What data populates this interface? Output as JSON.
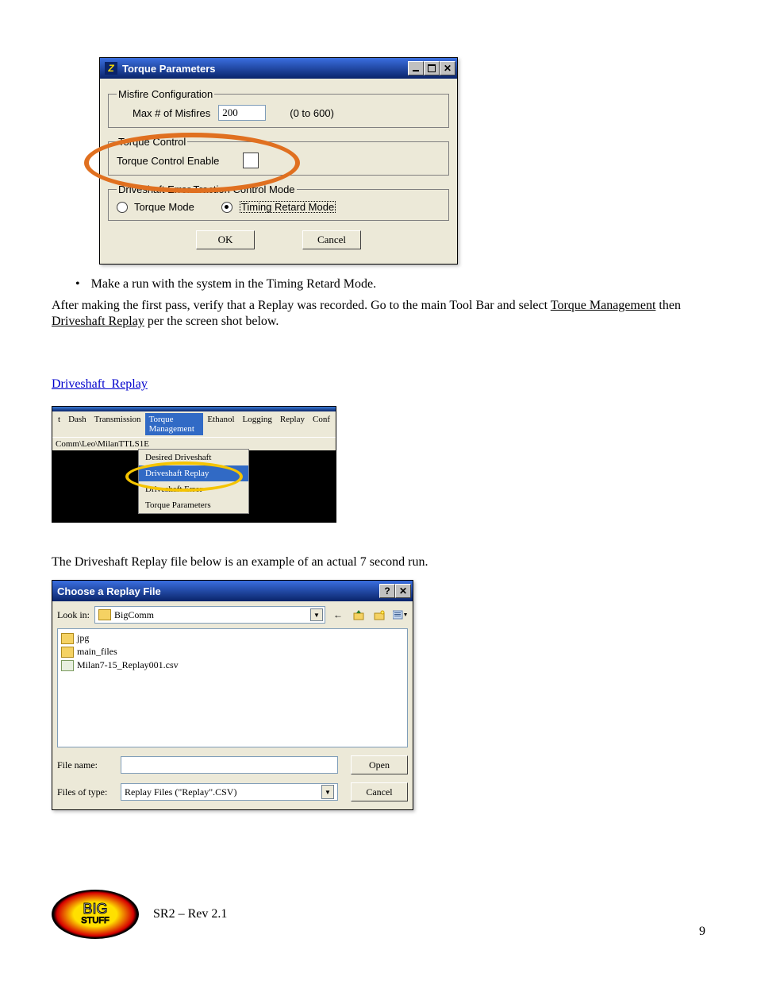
{
  "torqueDialog": {
    "title": "Torque Parameters",
    "group1": {
      "legend": "Misfire Configuration",
      "maxMisfiresLabel": "Max # of Misfires",
      "maxMisfiresValue": "200",
      "rangeHint": "(0 to 600)"
    },
    "group2": {
      "legend": "Torque Control",
      "enableLabel": "Torque Control Enable"
    },
    "group3": {
      "legend": "Driveshaft Error Traction Control Mode",
      "option1": "Torque Mode",
      "option2": "Timing Retard Mode"
    },
    "ok": "OK",
    "cancel": "Cancel"
  },
  "bullet_text": "Make a run with the system in the Timing Retard Mode.",
  "paragraph1_a": "After making the first pass, verify that a Replay was recorded.  Go to the main Tool Bar and select ",
  "paragraph1_b": "Torque Management",
  "paragraph1_c": " then ",
  "paragraph1_d": "Driveshaft Replay",
  "paragraph1_e": " per the screen shot below.",
  "sectionHeading": "Driveshaft_Replay",
  "menushot": {
    "items": [
      "t",
      "Dash",
      "Transmission",
      "Torque Management",
      "Ethanol",
      "Logging",
      "Replay",
      "Conf"
    ],
    "path": "Comm\\Leo\\MilanTTLS1E",
    "dd": [
      "Desired Driveshaft",
      "Driveshaft Replay",
      "Driveshaft Error",
      "Torque Parameters"
    ]
  },
  "paragraph2": "The Driveshaft Replay file below is an example of an actual 7 second run.",
  "fileDialog": {
    "title": "Choose a Replay File",
    "lookInLabel": "Look in:",
    "lookInValue": "BigComm",
    "items": [
      {
        "icon": "folder",
        "name": "jpg"
      },
      {
        "icon": "folder",
        "name": "main_files"
      },
      {
        "icon": "csv",
        "name": "Milan7-15_Replay001.csv"
      }
    ],
    "fileNameLabel": "File name:",
    "fileNameValue": "",
    "filesTypeLabel": "Files of type:",
    "filesTypeValue": "Replay Files (\"Replay\".CSV)",
    "open": "Open",
    "cancel": "Cancel"
  },
  "footer": {
    "logoTop": "BIG",
    "logoBot": "STUFF",
    "pageLabel": "SR2 – Rev 2.1",
    "pageNum": "9"
  }
}
